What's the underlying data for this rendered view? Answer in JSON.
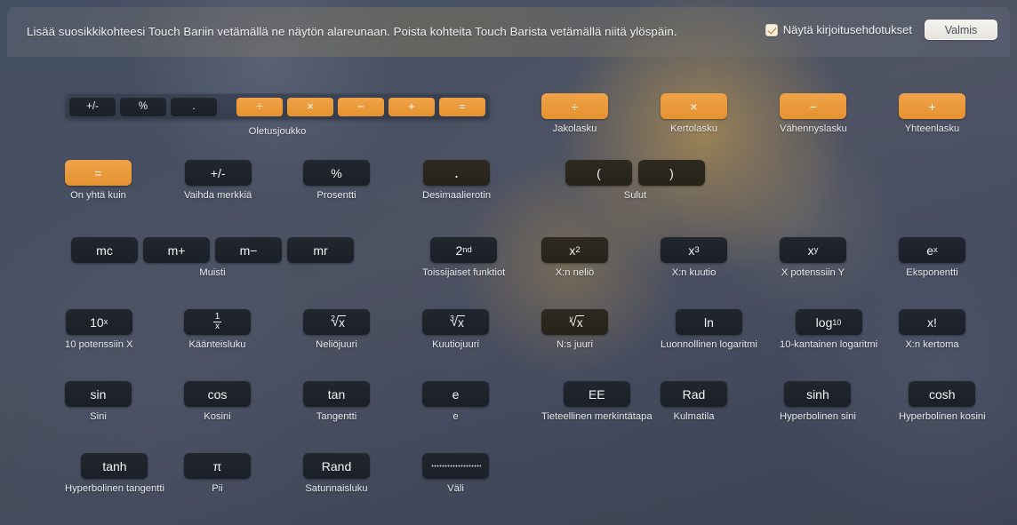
{
  "header": {
    "instruction": "Lisää suosikkikohteesi Touch Bariin vetämällä ne näytön alareunaan. Poista kohteita Touch Barista vetämällä niitä ylöspäin.",
    "checkbox_label": "Näytä kirjoitusehdotukset",
    "checkbox_checked": true,
    "done_label": "Valmis"
  },
  "colors": {
    "accent_orange": "#eb9a35",
    "key_dark": "#1e222b",
    "caption": "#e9eaed"
  },
  "default_set": {
    "caption": "Oletusjoukko",
    "keys": [
      {
        "glyph": "+/-",
        "style": "dark"
      },
      {
        "glyph": "%",
        "style": "dark"
      },
      {
        "glyph": ".",
        "style": "dark"
      },
      {
        "glyph": "÷",
        "style": "orange"
      },
      {
        "glyph": "×",
        "style": "orange"
      },
      {
        "glyph": "−",
        "style": "orange"
      },
      {
        "glyph": "+",
        "style": "orange"
      },
      {
        "glyph": "=",
        "style": "orange"
      }
    ]
  },
  "rows": [
    {
      "name": "row-operators",
      "items": [
        {
          "glyph": "÷",
          "caption": "Jakolasku",
          "style": "orange"
        },
        {
          "glyph": "×",
          "caption": "Kertolasku",
          "style": "orange"
        },
        {
          "glyph": "−",
          "caption": "Vähennyslasku",
          "style": "orange"
        },
        {
          "glyph": "+",
          "caption": "Yhteenlasku",
          "style": "orange"
        }
      ]
    },
    {
      "name": "row-basic",
      "items": [
        {
          "glyph": "=",
          "caption": "On yhtä kuin",
          "style": "orange"
        },
        {
          "glyph": "+/-",
          "caption": "Vaihda merkkiä",
          "style": "dark"
        },
        {
          "glyph": "%",
          "caption": "Prosentti",
          "style": "dark"
        },
        {
          "glyph": ".",
          "caption": "Desimaalierotin",
          "style": "warm"
        },
        {
          "glyph": "(",
          "caption": "",
          "style": "warm"
        },
        {
          "glyph": ")",
          "caption": "",
          "style": "warm"
        }
      ],
      "group_caption": "Sulut"
    },
    {
      "name": "row-memory-powers",
      "items": [
        {
          "glyph": "mc",
          "caption": "",
          "style": "dark"
        },
        {
          "glyph": "m+",
          "caption": "",
          "style": "dark"
        },
        {
          "glyph": "m−",
          "caption": "",
          "style": "dark"
        },
        {
          "glyph": "mr",
          "caption": "",
          "style": "dark"
        },
        {
          "glyph": "2nd",
          "caption": "Toissijaiset funktiot",
          "style": "dark"
        },
        {
          "glyph": "x2",
          "caption": "X:n neliö",
          "style": "warm"
        },
        {
          "glyph": "x3",
          "caption": "X:n kuutio",
          "style": "dark"
        },
        {
          "glyph": "xy",
          "caption": "X potenssiin Y",
          "style": "dark"
        },
        {
          "glyph": "ex",
          "caption": "Eksponentti",
          "style": "dark"
        }
      ],
      "group_caption": "Muisti"
    },
    {
      "name": "row-roots-logs",
      "items": [
        {
          "glyph": "10x",
          "caption": "10 potenssiin X",
          "style": "dark"
        },
        {
          "glyph": "1/x",
          "caption": "Käänteisluku",
          "style": "dark"
        },
        {
          "glyph": "sqrt2",
          "caption": "Neliöjuuri",
          "style": "dark"
        },
        {
          "glyph": "sqrt3",
          "caption": "Kuutiojuuri",
          "style": "dark"
        },
        {
          "glyph": "sqrty",
          "caption": "N:s juuri",
          "style": "warm"
        },
        {
          "glyph": "ln",
          "caption": "Luonnollinen logaritmi",
          "style": "dark"
        },
        {
          "glyph": "log10",
          "caption": "10-kantainen logaritmi",
          "style": "dark"
        },
        {
          "glyph": "x!",
          "caption": "X:n kertoma",
          "style": "dark"
        }
      ]
    },
    {
      "name": "row-trig",
      "items": [
        {
          "glyph": "sin",
          "caption": "Sini",
          "style": "dark"
        },
        {
          "glyph": "cos",
          "caption": "Kosini",
          "style": "dark"
        },
        {
          "glyph": "tan",
          "caption": "Tangentti",
          "style": "dark"
        },
        {
          "glyph": "e",
          "caption": "e",
          "style": "dark"
        },
        {
          "glyph": "EE",
          "caption": "Tieteellinen merkintätapa",
          "style": "dark"
        },
        {
          "glyph": "Rad",
          "caption": "Kulmatila",
          "style": "dark"
        },
        {
          "glyph": "sinh",
          "caption": "Hyperbolinen sini",
          "style": "dark"
        },
        {
          "glyph": "cosh",
          "caption": "Hyperbolinen kosini",
          "style": "dark"
        }
      ]
    },
    {
      "name": "row-misc",
      "items": [
        {
          "glyph": "tanh",
          "caption": "Hyperbolinen tangentti",
          "style": "dark"
        },
        {
          "glyph": "π",
          "caption": "Pii",
          "style": "dark"
        },
        {
          "glyph": "Rand",
          "caption": "Satunnaisluku",
          "style": "dark"
        },
        {
          "glyph": "space",
          "caption": "Väli",
          "style": "dark"
        }
      ]
    }
  ]
}
